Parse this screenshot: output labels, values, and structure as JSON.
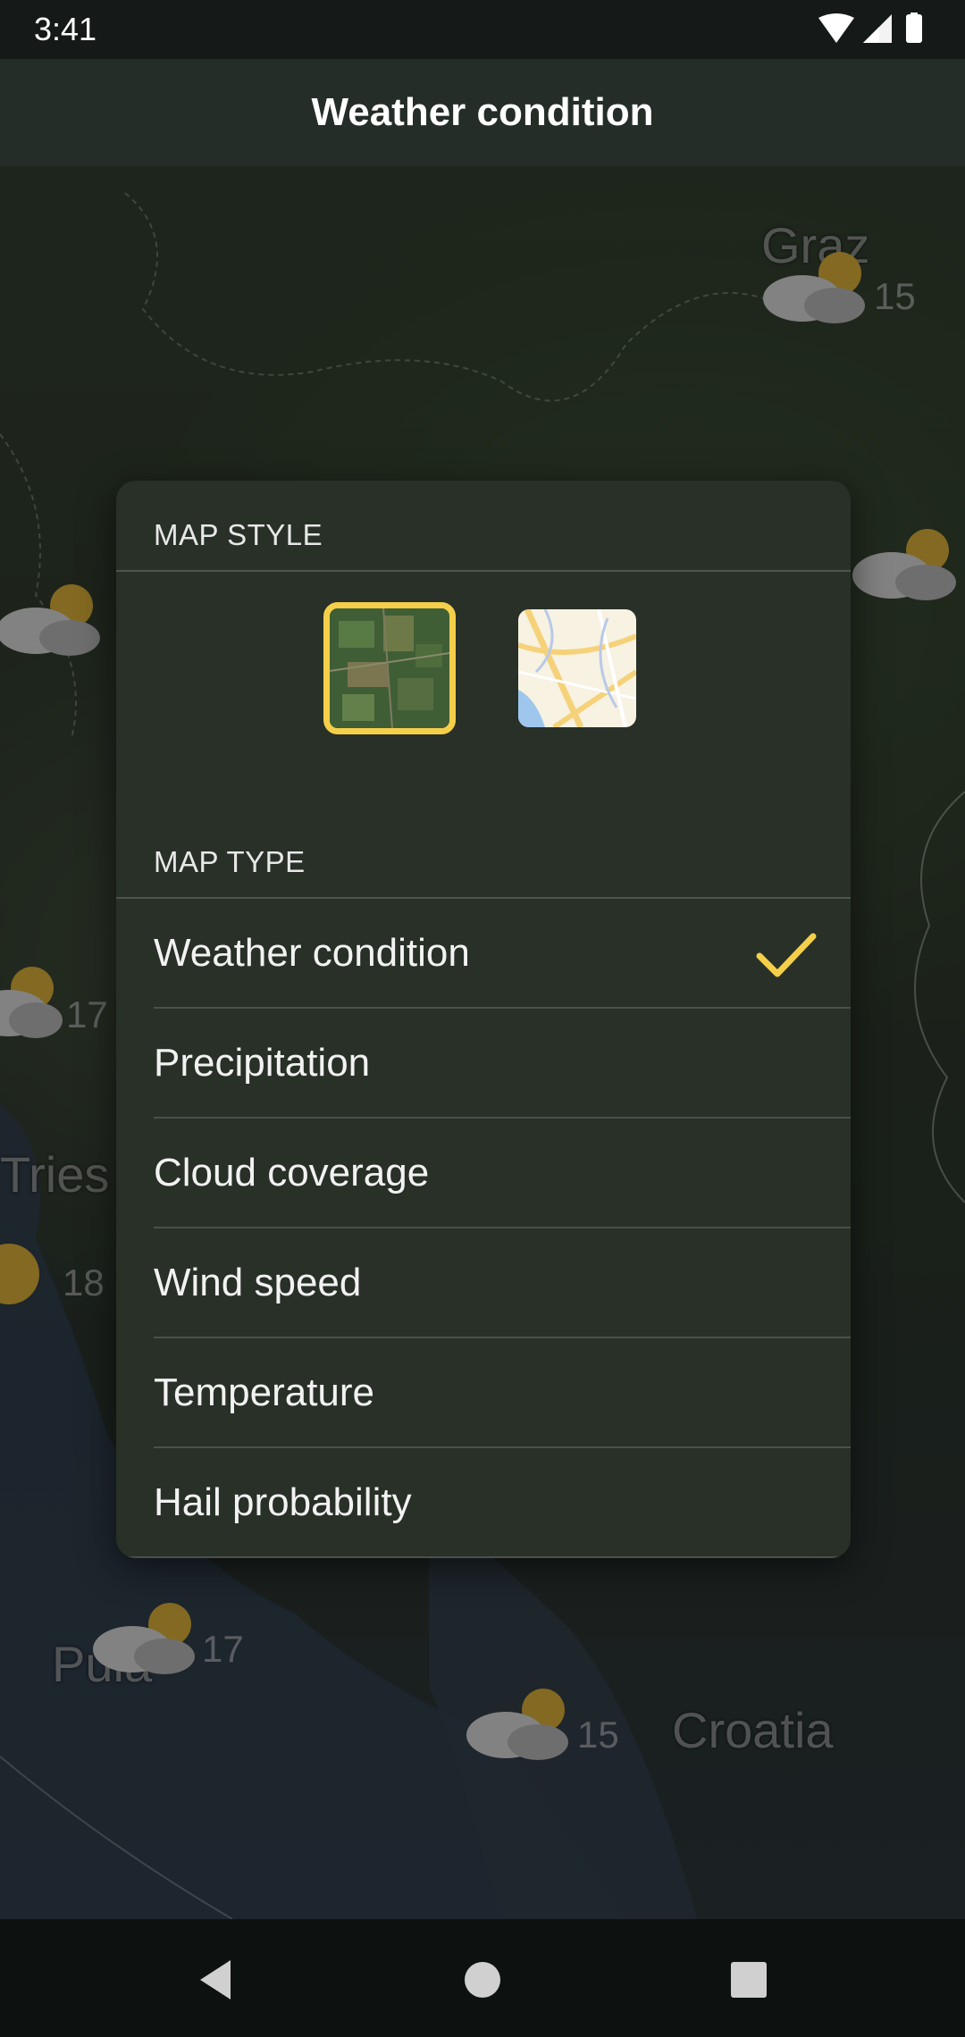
{
  "status_bar": {
    "time": "3:41"
  },
  "app_bar": {
    "title": "Weather condition"
  },
  "map": {
    "labels": {
      "graz": "Graz",
      "trieste": "Tries",
      "pula": "Pula",
      "croatia": "Croatia"
    },
    "temperatures": {
      "graz": "15",
      "west": "17",
      "trieste": "18",
      "pula": "17",
      "south": "15"
    }
  },
  "popup": {
    "map_style_header": "MAP STYLE",
    "map_type_header": "MAP TYPE",
    "map_types": [
      {
        "label": "Weather condition",
        "selected": true
      },
      {
        "label": "Precipitation",
        "selected": false
      },
      {
        "label": "Cloud coverage",
        "selected": false
      },
      {
        "label": "Wind speed",
        "selected": false
      },
      {
        "label": "Temperature",
        "selected": false
      },
      {
        "label": "Hail probability",
        "selected": false
      }
    ]
  },
  "colors": {
    "accent": "#f5cf4a",
    "popup_bg": "#283028"
  }
}
